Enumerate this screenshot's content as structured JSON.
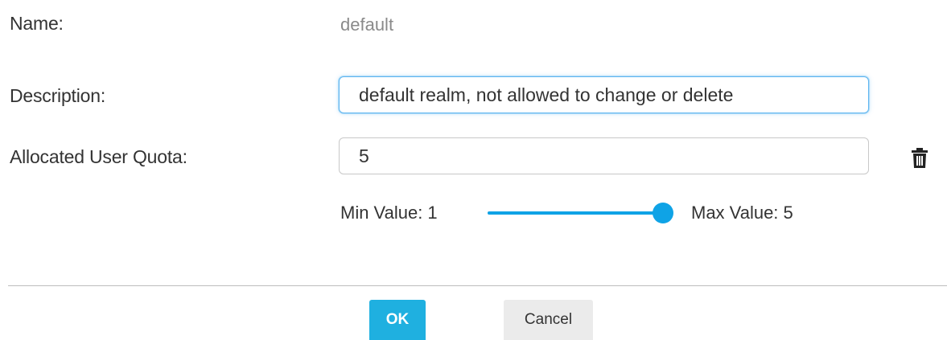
{
  "form": {
    "name_label": "Name:",
    "name_value": "default",
    "description_label": "Description:",
    "description_value": "default realm, not allowed to change or delete",
    "quota_label": "Allocated User Quota:",
    "quota_value": "5"
  },
  "slider": {
    "min_text": "Min Value: 1",
    "max_text": "Max Value: 5",
    "min": 1,
    "max": 5,
    "value": 5,
    "accent_color": "#0fa3e6"
  },
  "icons": {
    "delete": "trash-icon"
  },
  "buttons": {
    "ok_label": "OK",
    "cancel_label": "Cancel",
    "ok_color": "#1fb0e0",
    "cancel_color": "#ebebeb"
  }
}
